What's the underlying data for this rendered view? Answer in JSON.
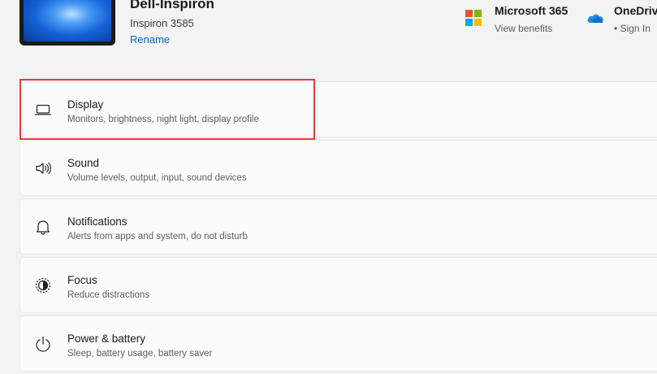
{
  "device": {
    "name": "Dell-Inspiron",
    "model": "Inspiron 3585",
    "rename_label": "Rename"
  },
  "microsoft365": {
    "title": "Microsoft 365",
    "subtitle": "View benefits"
  },
  "onedrive": {
    "title": "OneDriv",
    "subtitle": "• Sign In"
  },
  "settings": [
    {
      "title": "Display",
      "desc": "Monitors, brightness, night light, display profile",
      "icon": "monitor-icon"
    },
    {
      "title": "Sound",
      "desc": "Volume levels, output, input, sound devices",
      "icon": "speaker-icon"
    },
    {
      "title": "Notifications",
      "desc": "Alerts from apps and system, do not disturb",
      "icon": "bell-icon"
    },
    {
      "title": "Focus",
      "desc": "Reduce distractions",
      "icon": "focus-icon"
    },
    {
      "title": "Power & battery",
      "desc": "Sleep, battery usage, battery saver",
      "icon": "power-icon"
    }
  ],
  "colors": {
    "accent": "#0067c0",
    "highlight": "#e0403a",
    "background": "#f3f3f3",
    "card": "#fbfbfb"
  }
}
